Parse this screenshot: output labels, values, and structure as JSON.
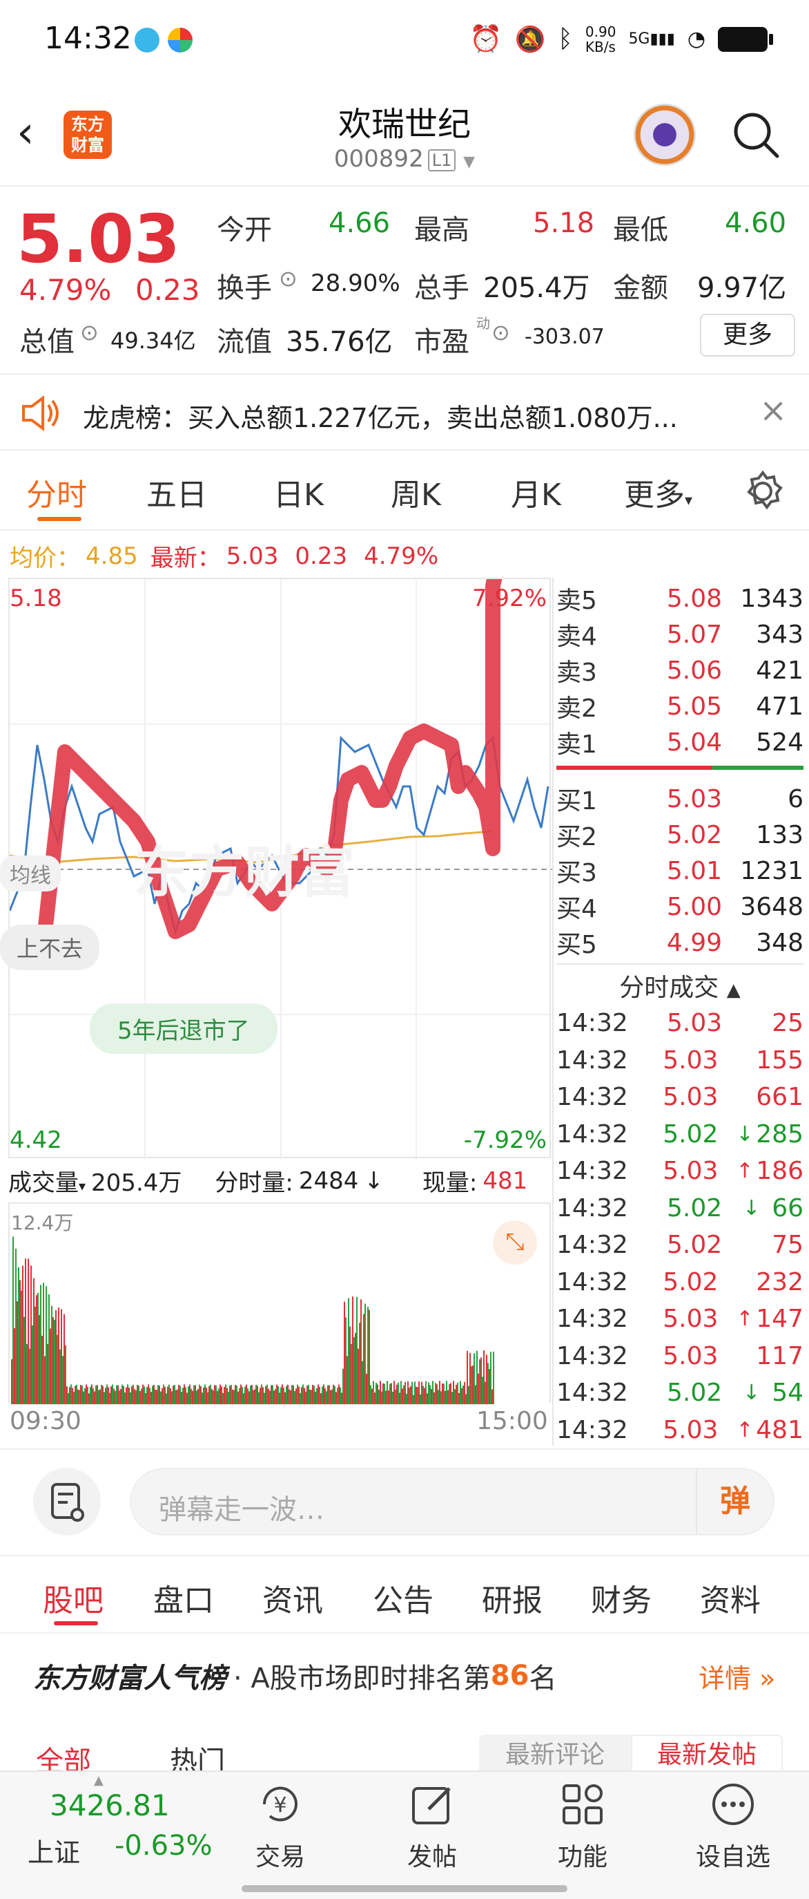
{
  "status_bar": {
    "time": "14:32",
    "net_speed": "0.90\nKB/s",
    "signal": "5G"
  },
  "header": {
    "title": "欢瑞世纪",
    "code": "000892",
    "level": "L1",
    "logo_text": "东方\n财富"
  },
  "quote": {
    "price": "5.03",
    "change_pct": "4.79%",
    "change": "0.23",
    "open_label": "今开",
    "open": "4.66",
    "high_label": "最高",
    "high": "5.18",
    "low_label": "最低",
    "low": "4.60",
    "turnover_label": "换手",
    "turnover": "28.90%",
    "volume_label": "总手",
    "volume": "205.4万",
    "amount_label": "金额",
    "amount": "9.97亿",
    "mktcap_label": "总值",
    "mktcap": "49.34亿",
    "float_label": "流值",
    "float_cap": "35.76亿",
    "pe_label": "市盈",
    "pe_sup": "动",
    "pe": "-303.07",
    "more_button": "更多"
  },
  "ticker": {
    "text": "龙虎榜：买入总额1.227亿元，卖出总额1.080万..."
  },
  "chart_tabs": [
    "分时",
    "五日",
    "日K",
    "周K",
    "月K",
    "更多"
  ],
  "chart_info": {
    "avg_label": "均价：",
    "avg": "4.85",
    "last_label": "最新：",
    "last": "5.03",
    "chg": "0.23",
    "pct": "4.79%"
  },
  "chart_axis": {
    "top_price": "5.18",
    "top_pct": "7.92%",
    "bottom_price": "4.42",
    "bottom_pct": "-7.92%",
    "time_start": "09:30",
    "time_end": "15:00",
    "vol_max": "12.4万"
  },
  "overlays": {
    "danmaku_1": "上不去",
    "danmaku_2": "5年后退市了",
    "left_tag": "均线",
    "watermark": "东方财富"
  },
  "volume_bar": {
    "label": "成交量",
    "total": "205.4万",
    "tick_label": "分时量:",
    "tick_val": "2484",
    "cur_label": "现量:",
    "cur_val": "481"
  },
  "order_book": {
    "asks": [
      {
        "label": "卖5",
        "price": "5.08",
        "vol": "1343"
      },
      {
        "label": "卖4",
        "price": "5.07",
        "vol": "343"
      },
      {
        "label": "卖3",
        "price": "5.06",
        "vol": "421"
      },
      {
        "label": "卖2",
        "price": "5.05",
        "vol": "471"
      },
      {
        "label": "卖1",
        "price": "5.04",
        "vol": "524"
      }
    ],
    "bids": [
      {
        "label": "买1",
        "price": "5.03",
        "vol": "6"
      },
      {
        "label": "买2",
        "price": "5.02",
        "vol": "133"
      },
      {
        "label": "买3",
        "price": "5.01",
        "vol": "1231"
      },
      {
        "label": "买4",
        "price": "5.00",
        "vol": "3648"
      },
      {
        "label": "买5",
        "price": "4.99",
        "vol": "348"
      }
    ]
  },
  "trades_title": "分时成交",
  "trades": [
    {
      "t": "14:32",
      "p": "5.03",
      "a": "",
      "v": "25",
      "c": "red"
    },
    {
      "t": "14:32",
      "p": "5.03",
      "a": "",
      "v": "155",
      "c": "red"
    },
    {
      "t": "14:32",
      "p": "5.03",
      "a": "",
      "v": "661",
      "c": "red"
    },
    {
      "t": "14:32",
      "p": "5.02",
      "a": "↓",
      "v": "285",
      "c": "green"
    },
    {
      "t": "14:32",
      "p": "5.03",
      "a": "↑",
      "v": "186",
      "c": "red"
    },
    {
      "t": "14:32",
      "p": "5.02",
      "a": "↓",
      "v": "66",
      "c": "green"
    },
    {
      "t": "14:32",
      "p": "5.02",
      "a": "",
      "v": "75",
      "c": "red"
    },
    {
      "t": "14:32",
      "p": "5.02",
      "a": "",
      "v": "232",
      "c": "red"
    },
    {
      "t": "14:32",
      "p": "5.03",
      "a": "↑",
      "v": "147",
      "c": "red"
    },
    {
      "t": "14:32",
      "p": "5.03",
      "a": "",
      "v": "117",
      "c": "red"
    },
    {
      "t": "14:32",
      "p": "5.02",
      "a": "↓",
      "v": "54",
      "c": "green"
    },
    {
      "t": "14:32",
      "p": "5.03",
      "a": "↑",
      "v": "481",
      "c": "red"
    }
  ],
  "comment_bar": {
    "placeholder": "弹幕走一波…",
    "send": "弹"
  },
  "bottom_tabs": [
    "股吧",
    "盘口",
    "资讯",
    "公告",
    "研报",
    "财务",
    "资料"
  ],
  "popularity": {
    "brand": "东方财富人气榜",
    "text_pre": "· A股市场即时排名第",
    "rank": "86",
    "text_post": "名",
    "detail": "详情"
  },
  "feed_tabs": {
    "all": "全部",
    "hot": "热门",
    "latest_comment": "最新评论",
    "latest_post": "最新发帖"
  },
  "index_ticker": {
    "value": "3426.81",
    "name": "上证",
    "pct": "-0.63%"
  },
  "nav": [
    "交易",
    "发帖",
    "功能",
    "设自选"
  ]
}
